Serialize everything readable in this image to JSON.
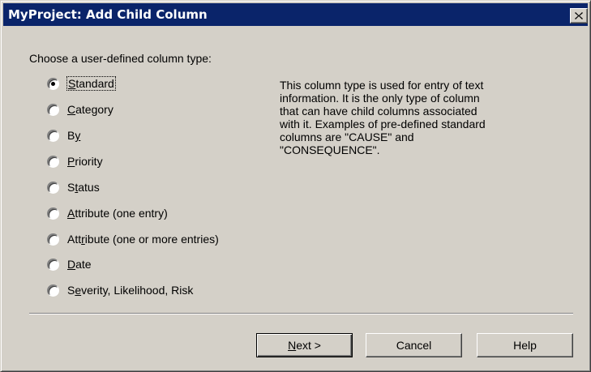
{
  "window": {
    "title": "MyProject: Add Child Column",
    "close_glyph": "✕"
  },
  "prompt": "Choose a user-defined column type:",
  "options": [
    {
      "pre": "",
      "key": "S",
      "post": "tandard",
      "selected": true
    },
    {
      "pre": "",
      "key": "C",
      "post": "ategory",
      "selected": false
    },
    {
      "pre": "B",
      "key": "y",
      "post": "",
      "selected": false
    },
    {
      "pre": "",
      "key": "P",
      "post": "riority",
      "selected": false
    },
    {
      "pre": "S",
      "key": "t",
      "post": "atus",
      "selected": false
    },
    {
      "pre": "",
      "key": "A",
      "post": "ttribute (one entry)",
      "selected": false
    },
    {
      "pre": "Att",
      "key": "r",
      "post": "ibute (one or more entries)",
      "selected": false
    },
    {
      "pre": "",
      "key": "D",
      "post": "ate",
      "selected": false
    },
    {
      "pre": "S",
      "key": "e",
      "post": "verity, Likelihood, Risk",
      "selected": false
    }
  ],
  "description": "This column type is used for entry of text\ninformation. It is the only type of column\nthat can have child columns associated\nwith it. Examples of pre-defined standard\ncolumns are \"CAUSE\" and\n\"CONSEQUENCE\".",
  "buttons": {
    "next": {
      "key": "N",
      "post": "ext >"
    },
    "cancel": "Cancel",
    "help": "Help"
  }
}
